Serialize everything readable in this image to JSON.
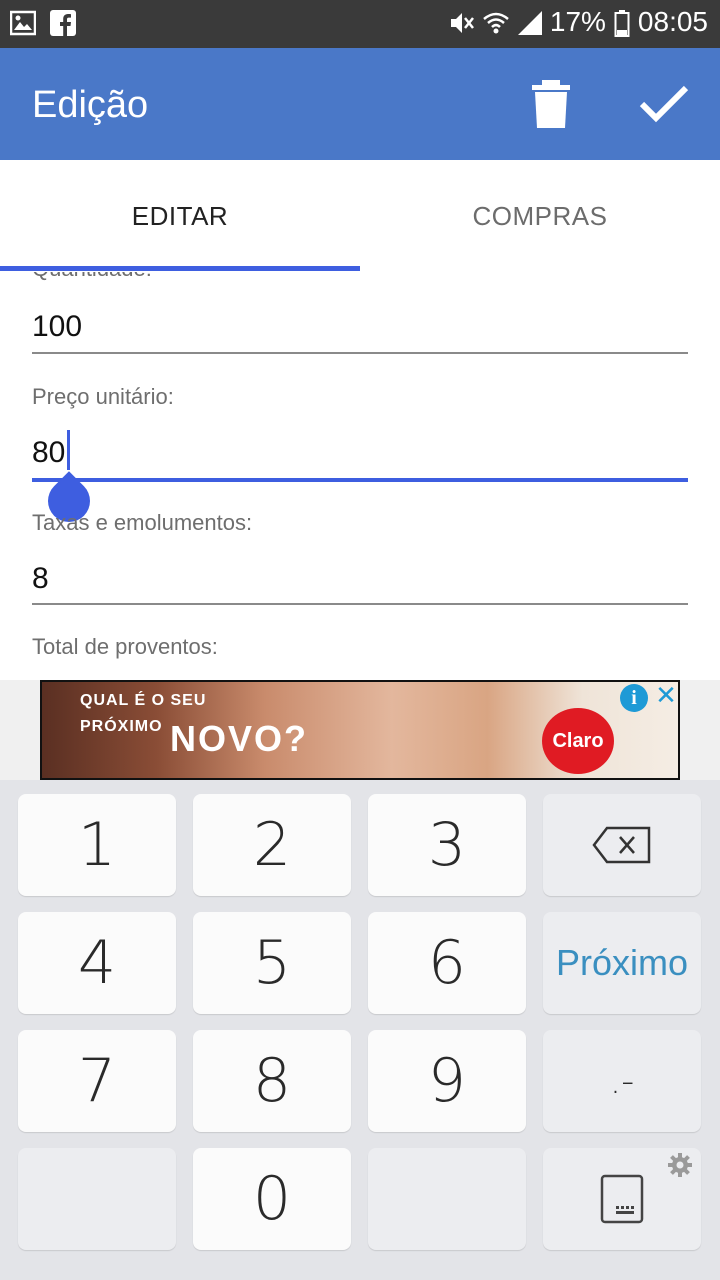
{
  "status_bar": {
    "battery_percent": "17%",
    "time": "08:05"
  },
  "app_bar": {
    "title": "Edição"
  },
  "tabs": [
    {
      "label": "EDITAR",
      "active": true
    },
    {
      "label": "COMPRAS",
      "active": false
    }
  ],
  "form": {
    "fields": [
      {
        "label": "Quantidade:",
        "value": "100"
      },
      {
        "label": "Preço unitário:",
        "value": "80"
      },
      {
        "label": "Taxas e emolumentos:",
        "value": "8"
      },
      {
        "label": "Total de proventos:",
        "value": ""
      }
    ]
  },
  "ad": {
    "headline_line1": "QUAL É O SEU",
    "headline_line2": "PRÓXIMO",
    "novo_text": "NOVO?",
    "brand": "Claro"
  },
  "keyboard": {
    "keys": [
      "1",
      "2",
      "3",
      "4",
      "5",
      "6",
      "7",
      "8",
      "9",
      "0"
    ],
    "next_label": "Próximo",
    "punct_label": ".-"
  },
  "colors": {
    "status_bar": "#3a3a3a",
    "app_bar": "#4a78c8",
    "accent": "#3e5ee0",
    "keyboard_bg": "#e3e4e8",
    "next_key_text": "#3a8fc0"
  }
}
